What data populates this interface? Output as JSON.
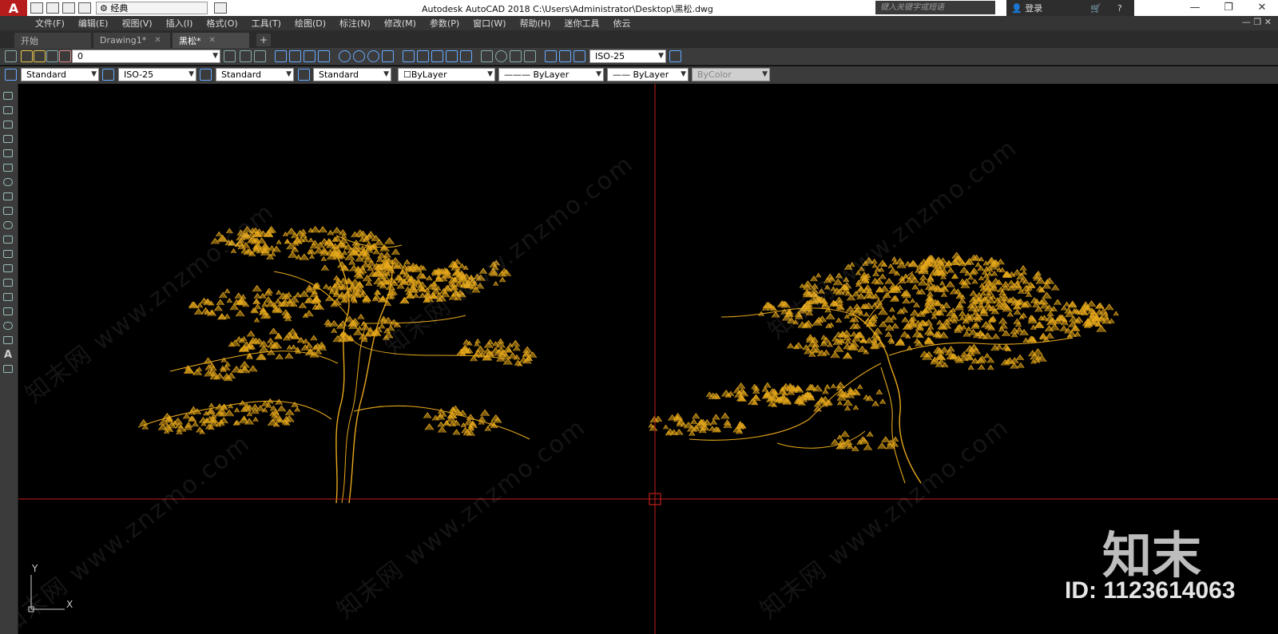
{
  "titlebar": {
    "app_logo": "A",
    "workspace": "经典",
    "title": "Autodesk AutoCAD 2018    C:\\Users\\Administrator\\Desktop\\黑松.dwg",
    "search_placeholder": "键入关键字或短语",
    "signin": "登录",
    "minimize": "—",
    "restore": "❐",
    "close": "✕"
  },
  "menu": {
    "items": [
      "文件(F)",
      "编辑(E)",
      "视图(V)",
      "插入(I)",
      "格式(O)",
      "工具(T)",
      "绘图(D)",
      "标注(N)",
      "修改(M)",
      "参数(P)",
      "窗口(W)",
      "帮助(H)",
      "迷你工具",
      "依云"
    ],
    "doc_controls": "— ❐ ✕"
  },
  "tabs": [
    {
      "label": "开始",
      "closable": false
    },
    {
      "label": "Drawing1*",
      "closable": true
    },
    {
      "label": "黑松*",
      "closable": true,
      "active": true
    }
  ],
  "tab_add": "+",
  "toolbar1": {
    "layer": "0",
    "dimstyle": "ISO-25"
  },
  "toolbar2": {
    "text_style": "Standard",
    "dim_style": "ISO-25",
    "table_style": "Standard",
    "multileader_style": "Standard",
    "color": "ByLayer",
    "linetype": "ByLayer",
    "lineweight": "ByLayer",
    "plotstyle": "ByColor"
  },
  "canvas": {
    "background": "#000000",
    "tree_color": "#e8a91c",
    "crosshair_color": "#c21d1d",
    "watermark": "知末网 www.znzmo.com",
    "ucs_x": "X",
    "ucs_y": "Y"
  },
  "brand": {
    "logo": "知末",
    "id": "ID: 1123614063"
  }
}
